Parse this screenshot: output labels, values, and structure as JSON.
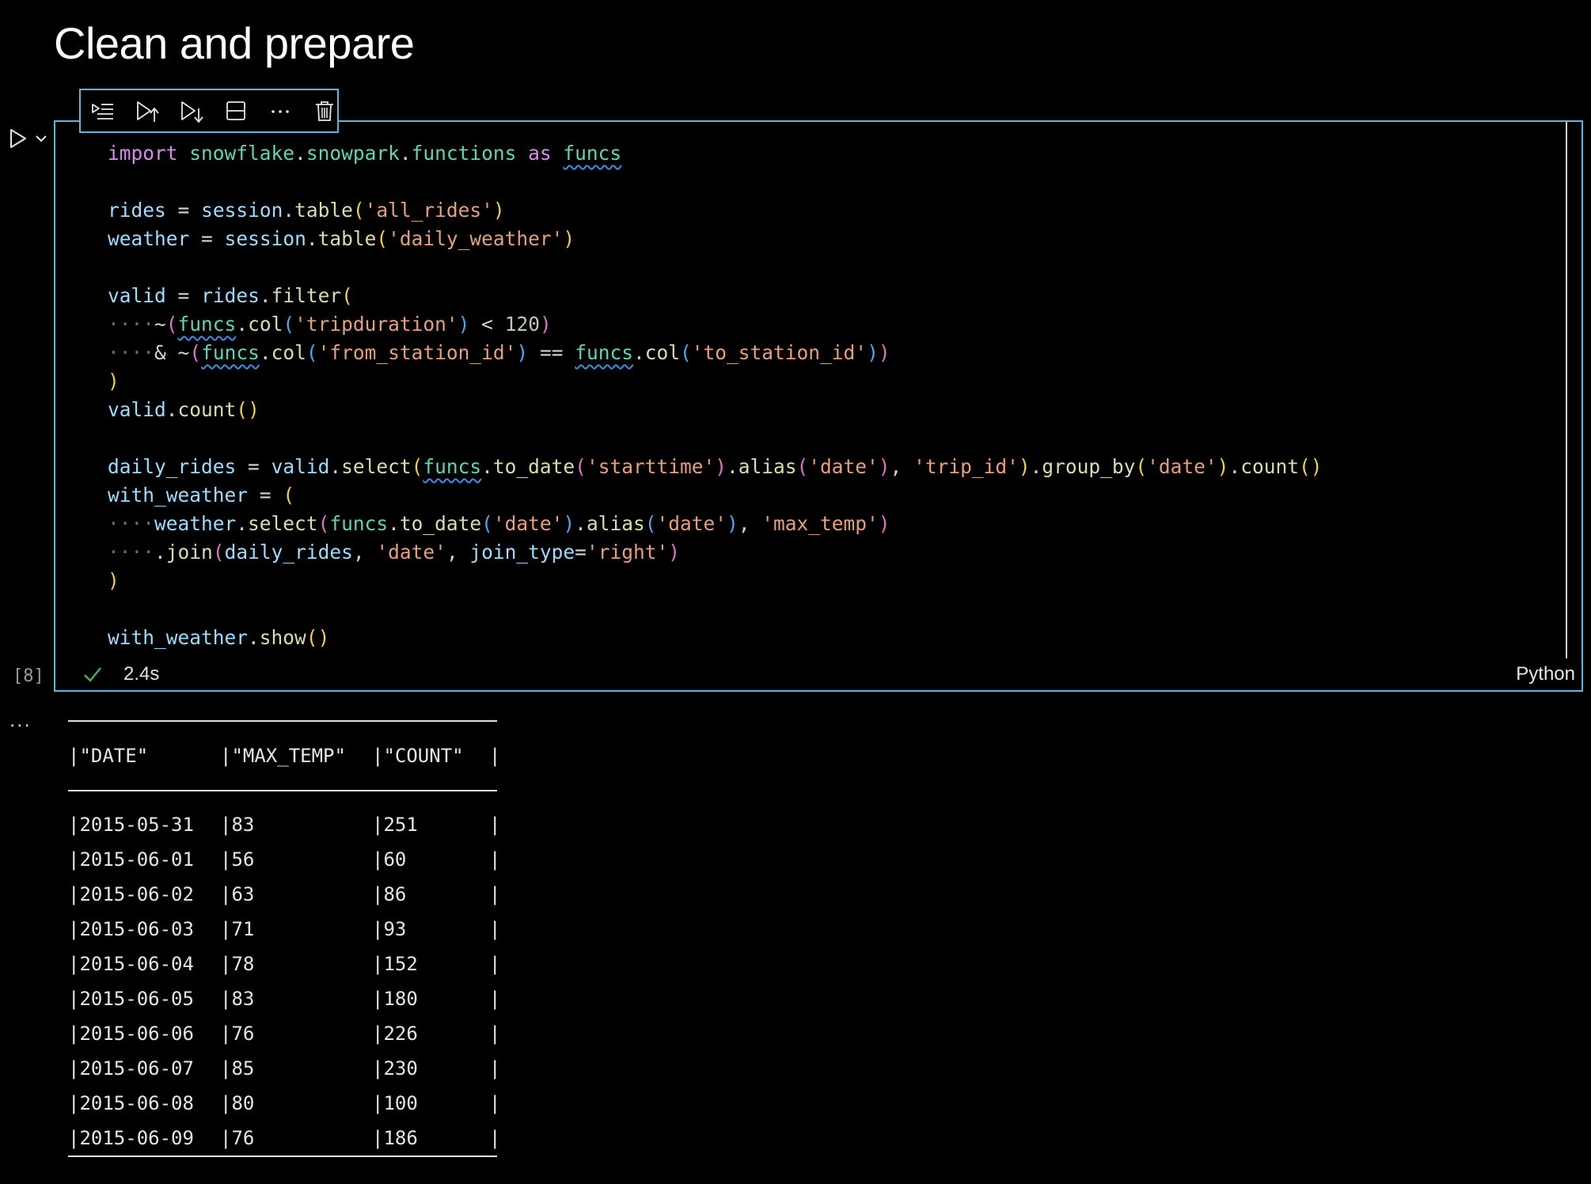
{
  "heading": "Clean and prepare",
  "cell": {
    "execution_count": "[8]",
    "exec_time": "2.4s",
    "language": "Python",
    "status": "success"
  },
  "toolbar": {
    "buttons": [
      {
        "name": "execute-above-icon",
        "label": "Execute above cells"
      },
      {
        "name": "run-above-icon",
        "label": "Execute cell and above"
      },
      {
        "name": "run-below-icon",
        "label": "Execute cell and below"
      },
      {
        "name": "split-cell-icon",
        "label": "Split cell"
      },
      {
        "name": "more-icon",
        "label": "More actions"
      },
      {
        "name": "delete-icon",
        "label": "Delete cell"
      }
    ]
  },
  "code": [
    "import snowflake.snowpark.functions as funcs",
    "",
    "rides = session.table('all_rides')",
    "weather = session.table('daily_weather')",
    "",
    "valid = rides.filter(",
    "    ~(funcs.col('tripduration') < 120)",
    "    & ~(funcs.col('from_station_id') == funcs.col('to_station_id'))",
    ")",
    "valid.count()",
    "",
    "daily_rides = valid.select(funcs.to_date('starttime').alias('date'), 'trip_id').group_by('date').count()",
    "with_weather = (",
    "    weather.select(funcs.to_date('date').alias('date'), 'max_temp')",
    "    .join(daily_rides, 'date', join_type='right')",
    ")",
    "",
    "with_weather.show()"
  ],
  "output": {
    "more_label": "...",
    "columns": [
      "\"DATE\"",
      "\"MAX_TEMP\"",
      "\"COUNT\""
    ],
    "rows": [
      [
        "2015-05-31",
        "83",
        "251"
      ],
      [
        "2015-06-01",
        "56",
        "60"
      ],
      [
        "2015-06-02",
        "63",
        "86"
      ],
      [
        "2015-06-03",
        "71",
        "93"
      ],
      [
        "2015-06-04",
        "78",
        "152"
      ],
      [
        "2015-06-05",
        "83",
        "180"
      ],
      [
        "2015-06-06",
        "76",
        "226"
      ],
      [
        "2015-06-07",
        "85",
        "230"
      ],
      [
        "2015-06-08",
        "80",
        "100"
      ],
      [
        "2015-06-09",
        "76",
        "186"
      ]
    ]
  },
  "colors": {
    "cell_border": "#5fb4e0",
    "background": "#000000",
    "success": "#3fb950"
  }
}
